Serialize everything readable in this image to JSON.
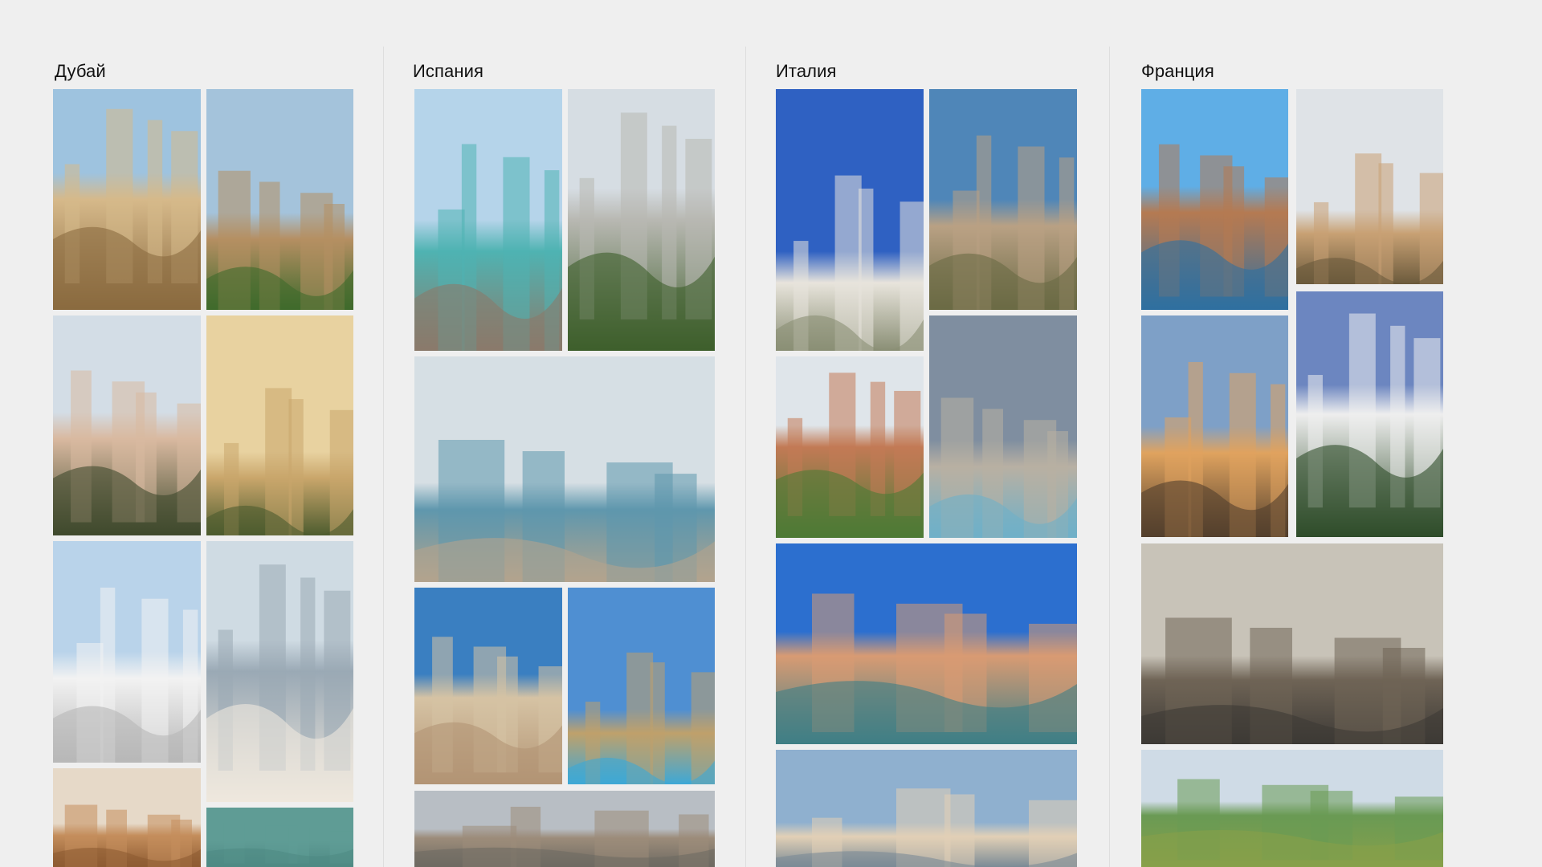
{
  "columns": [
    {
      "title": "Дубай",
      "photos": [
        {
          "name": "photo-dubai-arch-balcony",
          "palette": [
            "#9ec3df",
            "#d6b98a",
            "#8a6a3f"
          ]
        },
        {
          "name": "photo-dubai-fort-flags",
          "palette": [
            "#a4c3db",
            "#b58f62",
            "#3f6a2c"
          ]
        },
        {
          "name": "photo-dubai-desert-camels",
          "palette": [
            "#d3dde6",
            "#d9b9a0",
            "#3f4a2d"
          ]
        },
        {
          "name": "photo-dubai-old-town",
          "palette": [
            "#e8d2a0",
            "#c9a66b",
            "#4d5c2f"
          ]
        },
        {
          "name": "photo-dubai-grand-mosque",
          "palette": [
            "#b9d3ea",
            "#f2f2f2",
            "#b7b7b7"
          ]
        },
        {
          "name": "photo-dubai-skyline-beach",
          "palette": [
            "#cfdbe3",
            "#9aa9b5",
            "#efe8dd"
          ]
        },
        {
          "name": "photo-dubai-dunes",
          "palette": [
            "#e6d9c8",
            "#c48e5c",
            "#8e5b32"
          ]
        },
        {
          "name": "photo-dubai-teal-sky",
          "palette": [
            "#5f9c95",
            "#5f9c95",
            "#4f8a84"
          ]
        }
      ]
    },
    {
      "title": "Испания",
      "photos": [
        {
          "name": "photo-spain-coast-cove",
          "palette": [
            "#b5d4ea",
            "#4fb3b2",
            "#8b7a6b"
          ]
        },
        {
          "name": "photo-spain-building-flags",
          "palette": [
            "#d6dde3",
            "#b8b8b2",
            "#3e5f2c"
          ]
        },
        {
          "name": "photo-spain-harbor-view",
          "palette": [
            "#d6dfe4",
            "#5f97ad",
            "#b3a48e"
          ]
        },
        {
          "name": "photo-spain-city-hall",
          "palette": [
            "#3a7fc1",
            "#d6c3a4",
            "#b29474"
          ]
        },
        {
          "name": "photo-spain-cathedral-pool",
          "palette": [
            "#4f8fd2",
            "#bfa16b",
            "#3ea8d6"
          ]
        },
        {
          "name": "photo-spain-cloudy-town",
          "palette": [
            "#b8bec4",
            "#9c8c7a",
            "#6e6a62"
          ]
        }
      ]
    },
    {
      "title": "Италия",
      "photos": [
        {
          "name": "photo-italy-monument-flag",
          "palette": [
            "#2f61c2",
            "#e8e4dc",
            "#8a8f75"
          ]
        },
        {
          "name": "photo-italy-forum-ruins",
          "palette": [
            "#4f86b8",
            "#b9a184",
            "#6b6a45"
          ]
        },
        {
          "name": "photo-italy-rooftops",
          "palette": [
            "#dfe5ea",
            "#c27a55",
            "#4c7a35"
          ]
        },
        {
          "name": "photo-italy-pantheon",
          "palette": [
            "#7f8ea0",
            "#b8b0a3",
            "#6fb0c8"
          ]
        },
        {
          "name": "photo-italy-venice-canal",
          "palette": [
            "#2c6fcf",
            "#d89b73",
            "#3f7f86"
          ]
        },
        {
          "name": "photo-italy-venice-basilica",
          "palette": [
            "#8fb0cf",
            "#e2d0b6",
            "#7b8b96"
          ]
        }
      ]
    },
    {
      "title": "Франция",
      "photos": [
        {
          "name": "photo-france-eiffel-tower",
          "palette": [
            "#5faee6",
            "#b57a52",
            "#2f6fa0"
          ]
        },
        {
          "name": "photo-france-champagne-road",
          "palette": [
            "#dfe3e7",
            "#c8a174",
            "#6b5a3c"
          ]
        },
        {
          "name": "photo-france-castle-sunset",
          "palette": [
            "#7ea0c7",
            "#e0a35f",
            "#53402d"
          ]
        },
        {
          "name": "photo-france-alps-ski",
          "palette": [
            "#6c86c0",
            "#eeeeee",
            "#2f4c2a"
          ]
        },
        {
          "name": "photo-france-paris-street",
          "palette": [
            "#c8c3b8",
            "#6f6456",
            "#3d3a36"
          ]
        },
        {
          "name": "photo-france-vineyard",
          "palette": [
            "#cfdbe6",
            "#6a9a54",
            "#87a04a"
          ]
        }
      ]
    }
  ]
}
